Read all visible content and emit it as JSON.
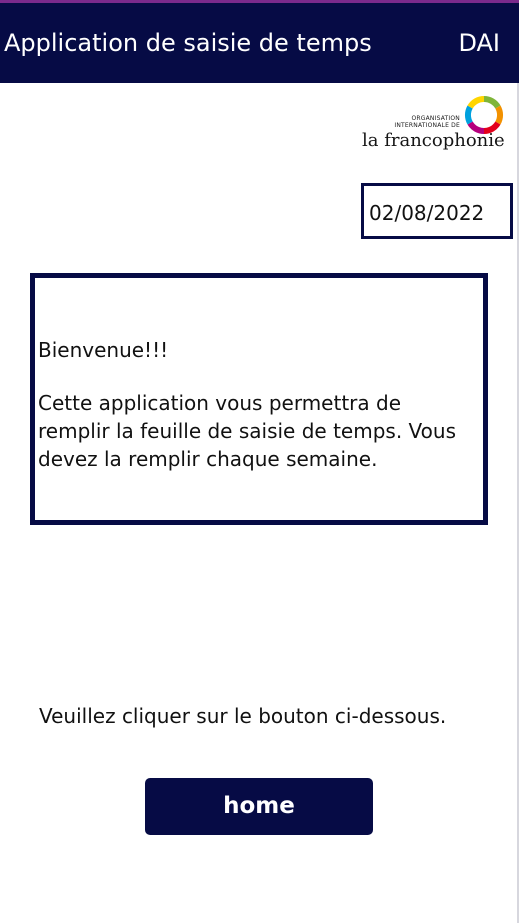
{
  "header": {
    "title": "Application de saisie de temps",
    "code": "DAI"
  },
  "logo": {
    "org_line1": "ORGANISATION",
    "org_line2": "INTERNATIONALE DE",
    "wordmark": "la francophonie"
  },
  "date_field": {
    "value": "02/08/2022"
  },
  "welcome": {
    "greeting": "Bienvenue!!!",
    "message": "Cette application vous permettra de remplir la feuille de saisie de temps. Vous devez la remplir chaque semaine."
  },
  "instruction": "Veuillez cliquer sur le bouton ci-dessous.",
  "home_button": {
    "label": "home"
  },
  "colors": {
    "header_bg": "#060b45",
    "accent_top": "#7a2a8c",
    "button_bg": "#060b45",
    "border": "#060b45",
    "logo_ring": [
      "#f29100",
      "#e3001b",
      "#b5007d",
      "#00a1de",
      "#7fb539",
      "#ffd500"
    ]
  }
}
